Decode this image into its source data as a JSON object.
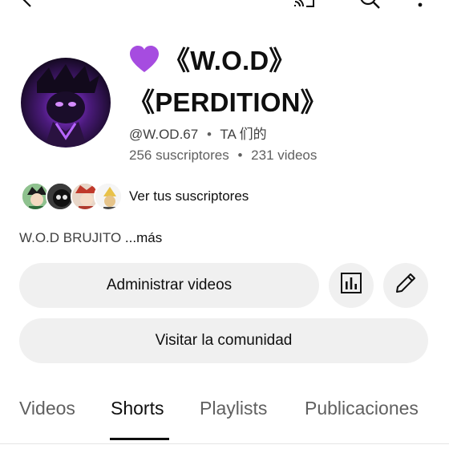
{
  "topbar": {
    "icons": [
      "back-icon",
      "cast-icon",
      "search-icon",
      "more-vert-icon"
    ]
  },
  "channel": {
    "title_line1": "《W.O.D》",
    "title_line2": "《PERDITION》",
    "title_emoji": "purple-heart-icon",
    "handle": "@W.OD.67",
    "sep1": "•",
    "ta_label": "TA 们的",
    "subscribers": "256 suscriptores",
    "sep2": "•",
    "videos": "231 videos",
    "see_subscribers": "Ver tus suscriptores",
    "description": "W.O.D BRUJITO ",
    "more": "...más"
  },
  "actions": {
    "manage_videos": "Administrar videos",
    "visit_community": "Visitar la comunidad",
    "analytics_icon": "analytics-icon",
    "edit_icon": "edit-pencil-icon"
  },
  "tabs": [
    {
      "label": "Videos",
      "active": false
    },
    {
      "label": "Shorts",
      "active": true
    },
    {
      "label": "Playlists",
      "active": false
    },
    {
      "label": "Publicaciones",
      "active": false
    }
  ],
  "colors": {
    "text_primary": "#0f0f0f",
    "text_secondary": "#606060",
    "button_bg": "#f0f0f0",
    "heart": "#a64ce0"
  }
}
